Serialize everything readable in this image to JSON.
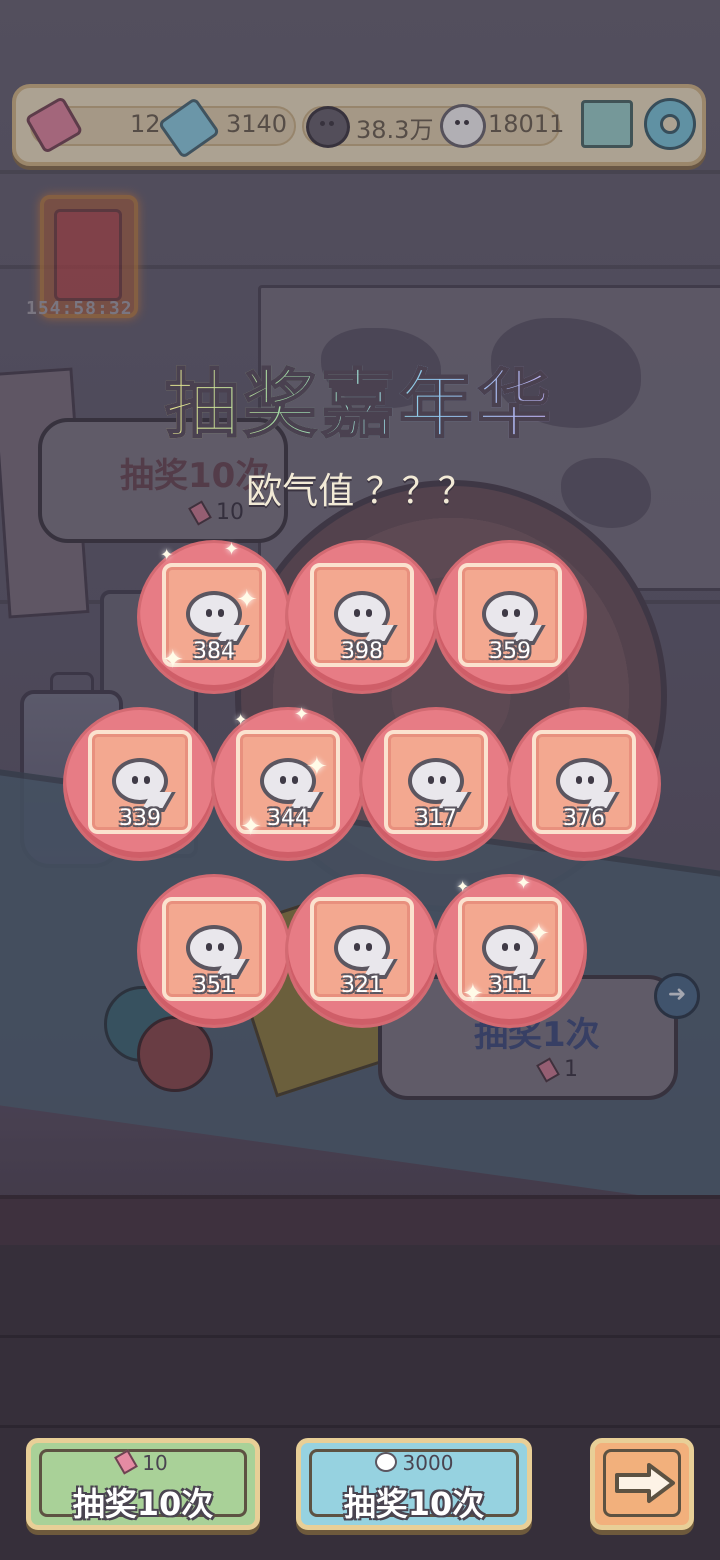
{
  "header": {
    "tickets": "12",
    "gifts": "3140",
    "dark_bubbles": "38.3万",
    "light_bubbles": "18011"
  },
  "event": {
    "timer": "154:58:32"
  },
  "title": "抽奖嘉年华",
  "luck_label": "欧气值 ？？？",
  "side_left": {
    "label": "抽奖10次",
    "cost": "10"
  },
  "side_right": {
    "label": "抽奖1次",
    "cost": "1"
  },
  "prizes": [
    "384",
    "398",
    "359",
    "339",
    "344",
    "317",
    "376",
    "351",
    "321",
    "311"
  ],
  "buttons": {
    "draw_ten_ticket": {
      "cost": "10",
      "label": "抽奖10次"
    },
    "draw_ten_bubble": {
      "cost": "3000",
      "label": "抽奖10次"
    }
  },
  "icons": {
    "ticket": "ticket-icon",
    "gift": "gift-icon",
    "dark_bubble": "chat-dark-icon",
    "light_bubble": "chat-light-icon",
    "mail": "mail-icon",
    "settings": "gear-icon",
    "prize": "ghost-icon",
    "next": "arrow-right-icon"
  },
  "colors": {
    "prize_circle": "#e77c85",
    "prize_box": "#f3a890",
    "green_button": "#a9d198",
    "blue_button": "#96d2e0",
    "orange_button": "#f2b07c"
  }
}
